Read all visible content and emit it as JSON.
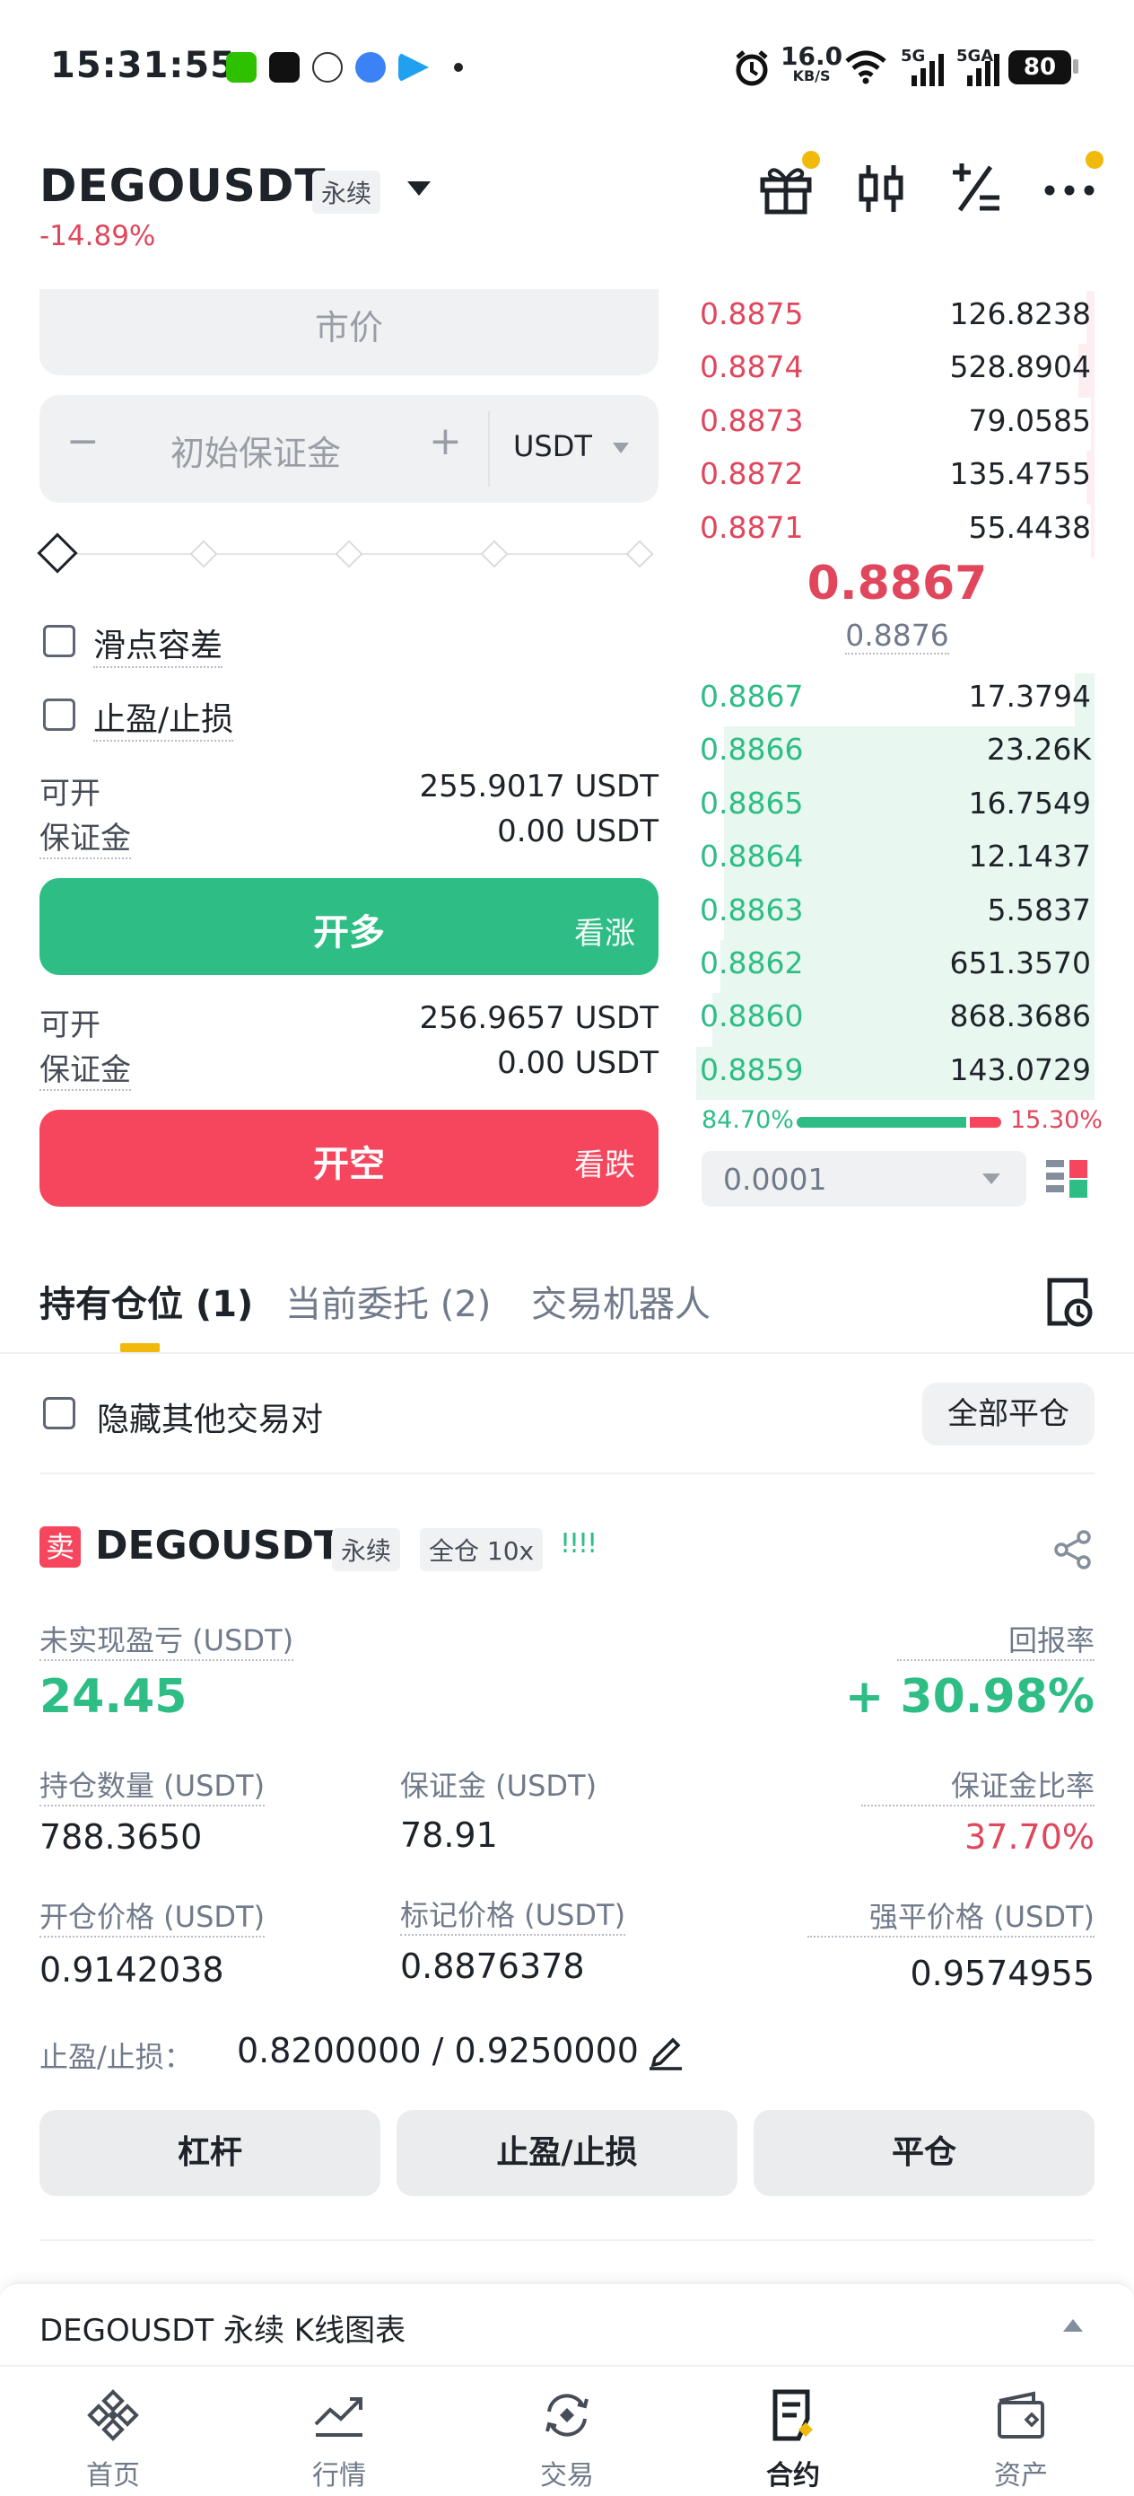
{
  "status_bar": {
    "time": "15:31:55",
    "net_speed_value": "16.0",
    "net_speed_unit": "KB/S",
    "sig1": "5G",
    "sig2": "5GA",
    "battery": "80"
  },
  "header": {
    "symbol": "DEGOUSDT",
    "contract_type": "永续",
    "change": "-14.89%"
  },
  "order_form": {
    "order_type": "市价",
    "margin_placeholder": "初始保证金",
    "minus": "−",
    "plus": "+",
    "currency": "USDT",
    "slippage_label": "滑点容差",
    "tpsl_label": "止盈/止损",
    "long": {
      "available_label": "可开",
      "available_value": "255.9017 USDT",
      "margin_label": "保证金",
      "margin_value": "0.00 USDT",
      "button_label": "开多",
      "button_sub": "看涨"
    },
    "short": {
      "available_label": "可开",
      "available_value": "256.9657 USDT",
      "margin_label": "保证金",
      "margin_value": "0.00 USDT",
      "button_label": "开空",
      "button_sub": "看跌"
    }
  },
  "order_book": {
    "asks": [
      {
        "price": "0.8875",
        "qty": "126.8238",
        "depth": 0.02
      },
      {
        "price": "0.8874",
        "qty": "528.8904",
        "depth": 0.04
      },
      {
        "price": "0.8873",
        "qty": "79.0585",
        "depth": 0.01
      },
      {
        "price": "0.8872",
        "qty": "135.4755",
        "depth": 0.02
      },
      {
        "price": "0.8871",
        "qty": "55.4438",
        "depth": 0.01
      }
    ],
    "last_price": "0.8867",
    "mark_price": "0.8876",
    "bids": [
      {
        "price": "0.8867",
        "qty": "17.3794",
        "depth": 0.05
      },
      {
        "price": "0.8866",
        "qty": "23.26K",
        "depth": 0.93
      },
      {
        "price": "0.8865",
        "qty": "16.7549",
        "depth": 0.93
      },
      {
        "price": "0.8864",
        "qty": "12.1437",
        "depth": 0.93
      },
      {
        "price": "0.8863",
        "qty": "5.5837",
        "depth": 0.93
      },
      {
        "price": "0.8862",
        "qty": "651.3570",
        "depth": 0.94
      },
      {
        "price": "0.8860",
        "qty": "868.3686",
        "depth": 0.96
      },
      {
        "price": "0.8859",
        "qty": "143.0729",
        "depth": 1.0
      }
    ],
    "buy_ratio": "84.70%",
    "sell_ratio": "15.30%",
    "buy_ratio_value": 0.847,
    "precision": "0.0001"
  },
  "tabs": [
    {
      "label": "持有仓位 (1)"
    },
    {
      "label": "当前委托 (2)"
    },
    {
      "label": "交易机器人"
    }
  ],
  "positions_toolbar": {
    "hide_other_label": "隐藏其他交易对",
    "close_all_label": "全部平仓"
  },
  "position": {
    "side": "卖",
    "symbol": "DEGOUSDT",
    "contract_type": "永续",
    "margin_mode": "全仓 10x",
    "signal": "!!!!",
    "unrealized_pnl_label": "未实现盈亏 (USDT)",
    "unrealized_pnl": "24.45",
    "roe_label": "回报率",
    "roe": "+ 30.98%",
    "size_label": "持仓数量 (USDT)",
    "size": "788.3650",
    "margin_label": "保证金 (USDT)",
    "margin": "78.91",
    "margin_ratio_label": "保证金比率",
    "margin_ratio": "37.70%",
    "entry_label": "开仓价格 (USDT)",
    "entry": "0.9142038",
    "mark_label": "标记价格 (USDT)",
    "mark": "0.8876378",
    "liq_label": "强平价格 (USDT)",
    "liq": "0.9574955",
    "tpsl_label": "止盈/止损：",
    "tpsl_value": "0.8200000 / 0.9250000",
    "buttons": [
      "杠杆",
      "止盈/止损",
      "平仓"
    ]
  },
  "chart_panel": {
    "title": "DEGOUSDT 永续 K线图表"
  },
  "bottom_nav": [
    {
      "label": "首页",
      "icon": "home-icon"
    },
    {
      "label": "行情",
      "icon": "markets-icon"
    },
    {
      "label": "交易",
      "icon": "trade-icon"
    },
    {
      "label": "合约",
      "icon": "futures-icon"
    },
    {
      "label": "资产",
      "icon": "wallet-icon"
    }
  ],
  "colors": {
    "green": "#2ebd85",
    "red": "#f6465d",
    "yellow": "#f0b90b"
  }
}
